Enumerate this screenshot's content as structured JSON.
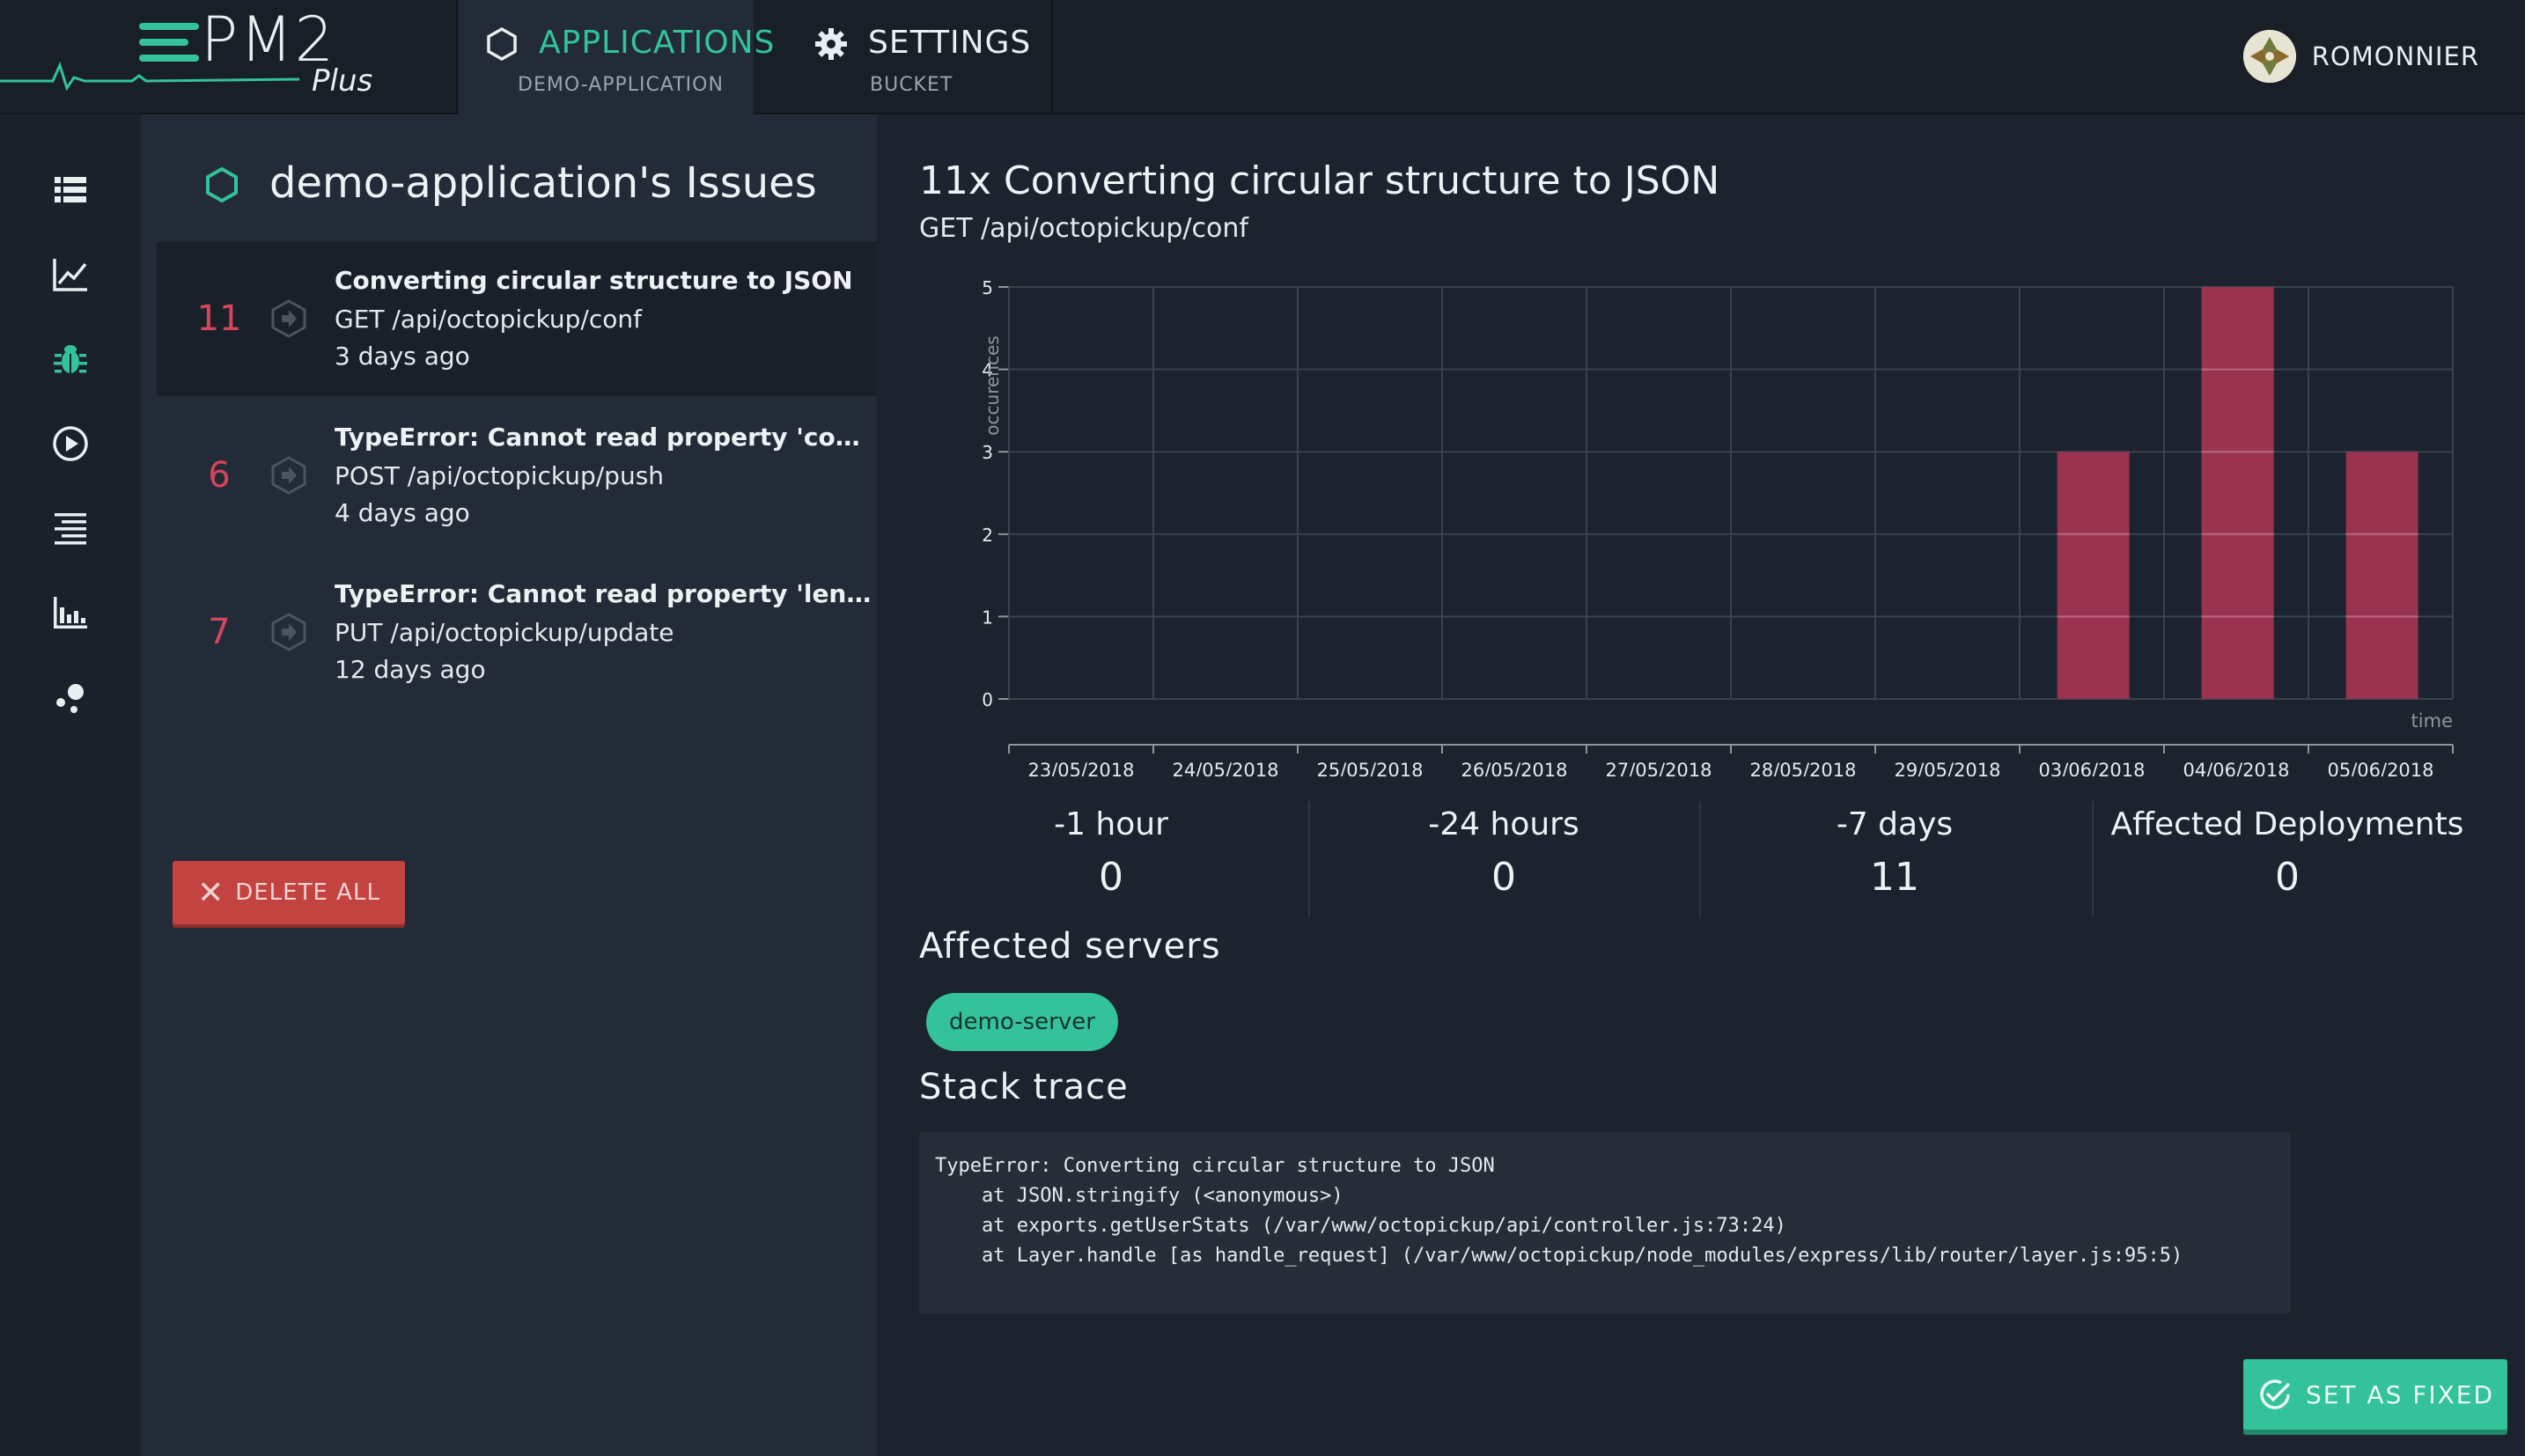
{
  "brand": {
    "name": "PM2",
    "suffix": "Plus",
    "accent": "#33c29a"
  },
  "nav": {
    "tabs": [
      {
        "label": "APPLICATIONS",
        "sublabel": "DEMO-APPLICATION",
        "icon": "hexagon-icon",
        "active": true
      },
      {
        "label": "SETTINGS",
        "sublabel": "BUCKET",
        "icon": "gear-icon",
        "active": false
      }
    ],
    "user": {
      "name": "ROMONNIER"
    }
  },
  "sidebar": {
    "items": [
      {
        "icon": "list-icon",
        "active": false
      },
      {
        "icon": "line-chart-icon",
        "active": false
      },
      {
        "icon": "bug-icon",
        "active": true
      },
      {
        "icon": "play-circle-icon",
        "active": false
      },
      {
        "icon": "logs-icon",
        "active": false
      },
      {
        "icon": "bar-chart-icon",
        "active": false
      },
      {
        "icon": "dots-icon",
        "active": false
      }
    ]
  },
  "issues": {
    "title": "demo-application's Issues",
    "items": [
      {
        "count": "11",
        "title": "Converting circular structure to JSON",
        "route": "GET /api/octopickup/conf",
        "time": "3 days ago",
        "selected": true
      },
      {
        "count": "6",
        "title": "TypeError: Cannot read property 'conf' of un...",
        "route": "POST /api/octopickup/push",
        "time": "4 days ago",
        "selected": false
      },
      {
        "count": "7",
        "title": "TypeError: Cannot read property 'length' of n...",
        "route": "PUT /api/octopickup/update",
        "time": "12 days ago",
        "selected": false
      }
    ],
    "delete_all_label": "DELETE ALL"
  },
  "detail": {
    "title": "11x Converting circular structure to JSON",
    "route": "GET /api/octopickup/conf",
    "stats": [
      {
        "label": "-1 hour",
        "value": "0"
      },
      {
        "label": "-24 hours",
        "value": "0"
      },
      {
        "label": "-7 days",
        "value": "11"
      },
      {
        "label": "Affected Deployments",
        "value": "0"
      }
    ],
    "servers_title": "Affected servers",
    "servers": [
      "demo-server"
    ],
    "stack_title": "Stack trace",
    "stack_trace": "TypeError: Converting circular structure to JSON\n    at JSON.stringify (<anonymous>)\n    at exports.getUserStats (/var/www/octopickup/api/controller.js:73:24)\n    at Layer.handle [as handle_request] (/var/www/octopickup/node_modules/express/lib/router/layer.js:95:5)",
    "set_fixed_label": "SET AS FIXED"
  },
  "chart_data": {
    "type": "bar",
    "categories": [
      "23/05/2018",
      "24/05/2018",
      "25/05/2018",
      "26/05/2018",
      "27/05/2018",
      "28/05/2018",
      "29/05/2018",
      "03/06/2018",
      "04/06/2018",
      "05/06/2018"
    ],
    "values": [
      0,
      0,
      0,
      0,
      0,
      0,
      0,
      3,
      5,
      3
    ],
    "ylabel": "occurences",
    "xlabel": "time",
    "ylim": [
      0,
      5
    ],
    "yticks": [
      0,
      1,
      2,
      3,
      4,
      5
    ],
    "grid": true,
    "bar_color": "#9a3350"
  }
}
